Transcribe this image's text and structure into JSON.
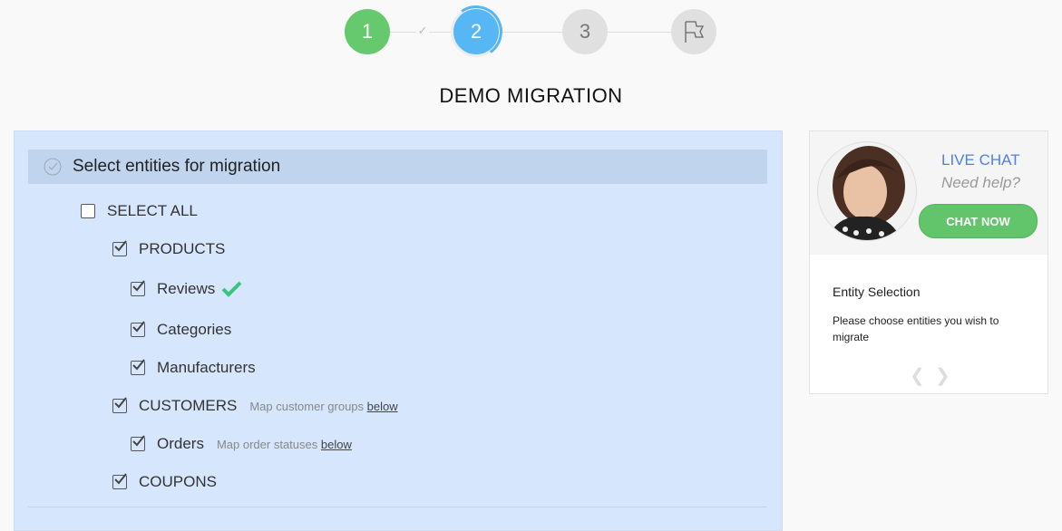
{
  "stepper": {
    "steps": [
      {
        "label": "1",
        "state": "completed",
        "color": "#66c96e"
      },
      {
        "label": "2",
        "state": "active",
        "color": "#57b7f5"
      },
      {
        "label": "3",
        "state": "pending"
      },
      {
        "label": "finish",
        "icon": "flag-icon",
        "state": "pending"
      }
    ],
    "separator_icon": "check-icon"
  },
  "page": {
    "title": "DEMO MIGRATION"
  },
  "panel": {
    "heading": "Select entities for migration",
    "select_all": {
      "label": "SELECT ALL",
      "checked": false
    },
    "items": [
      {
        "label": "PRODUCTS",
        "checked": true,
        "level": 1
      },
      {
        "label": "Reviews",
        "checked": true,
        "level": 2,
        "badge": "check-icon",
        "badge_color": "#3cc47c"
      },
      {
        "label": "Categories",
        "checked": true,
        "level": 2
      },
      {
        "label": "Manufacturers",
        "checked": true,
        "level": 2
      },
      {
        "label": "CUSTOMERS",
        "checked": true,
        "level": 1,
        "note": "Map customer groups",
        "note_link": "below"
      },
      {
        "label": "Orders",
        "checked": true,
        "level": 2,
        "note": "Map order statuses",
        "note_link": "below"
      },
      {
        "label": "COUPONS",
        "checked": true,
        "level": 1
      }
    ]
  },
  "sidebar": {
    "live_chat": "LIVE CHAT",
    "need_help": "Need help?",
    "chat_button": "CHAT NOW",
    "info_title": "Entity Selection",
    "info_text": "Please choose entities you wish to migrate"
  },
  "colors": {
    "accent_blue": "#4d7ff0",
    "success_green": "#62c46b",
    "panel_bg": "#d6e6fd"
  }
}
